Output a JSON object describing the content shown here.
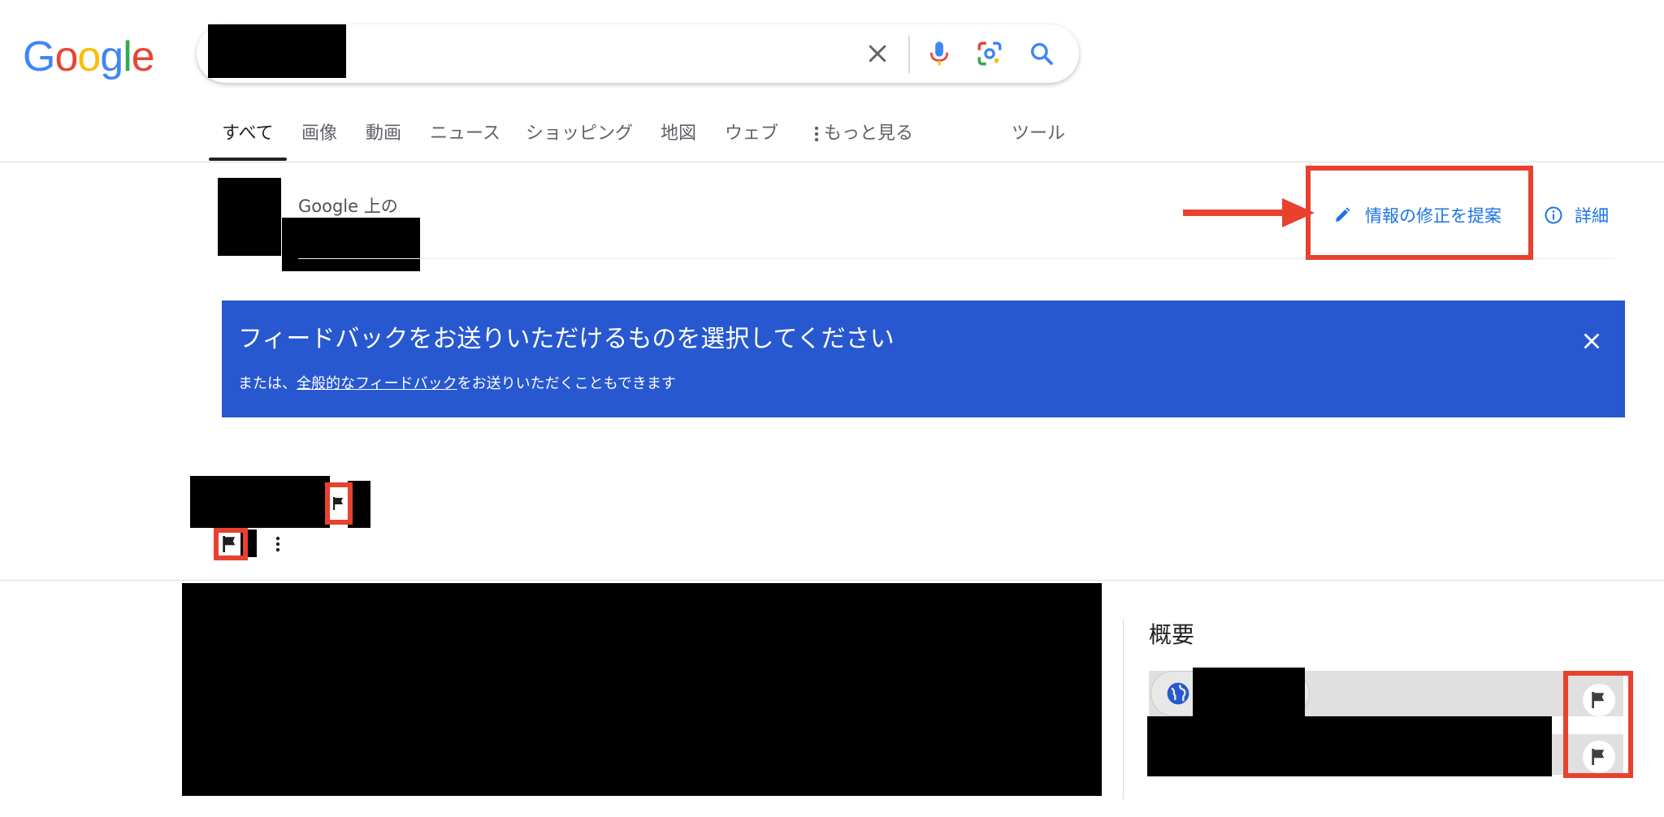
{
  "logo": {
    "letters": [
      "G",
      "o",
      "o",
      "g",
      "l",
      "e"
    ],
    "colors": [
      "#4285F4",
      "#EA4335",
      "#FBBC05",
      "#4285F4",
      "#34A853",
      "#EA4335"
    ]
  },
  "search": {
    "value": "",
    "placeholder": ""
  },
  "tabs": [
    {
      "label": "すべて",
      "active": true
    },
    {
      "label": "画像"
    },
    {
      "label": "動画"
    },
    {
      "label": "ニュース"
    },
    {
      "label": "ショッピング"
    },
    {
      "label": "地図"
    },
    {
      "label": "ウェブ"
    },
    {
      "label": "もっと見る"
    },
    {
      "label": "ツール"
    }
  ],
  "knowledge": {
    "google_prefix": "Google 上の",
    "suggest_edit": "情報の修正を提案",
    "details": "詳細"
  },
  "banner": {
    "title": "フィードバックをお送りいただけるものを選択してください",
    "sub_prefix": "または、",
    "sub_link": "全般的なフィードバック",
    "sub_suffix": "をお送りいただくこともできます"
  },
  "overview": {
    "heading": "概要"
  },
  "colors": {
    "accent": "#1a73e8",
    "banner_bg": "#2758d0",
    "annotation_red": "#e8412e"
  }
}
